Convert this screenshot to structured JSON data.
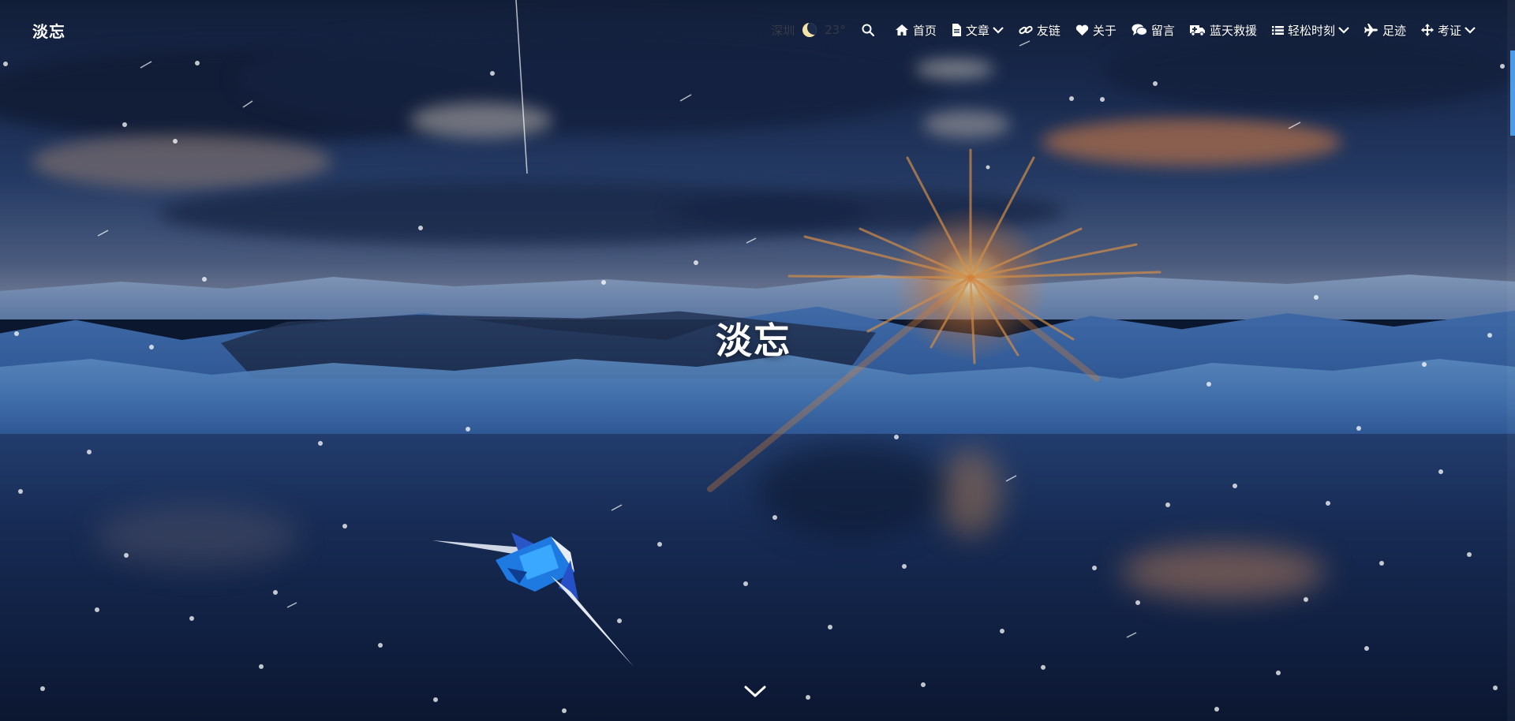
{
  "site": {
    "brand": "淡忘",
    "hero_title": "淡忘"
  },
  "weather": {
    "city": "深圳",
    "temperature": "23°"
  },
  "nav": {
    "items": [
      {
        "label": "首页",
        "icon": "home-icon"
      },
      {
        "label": "文章",
        "icon": "file-icon",
        "has_dropdown": true
      },
      {
        "label": "友链",
        "icon": "link-icon"
      },
      {
        "label": "关于",
        "icon": "heart-icon"
      },
      {
        "label": "留言",
        "icon": "comments-icon"
      },
      {
        "label": "蓝天救援",
        "icon": "truck-icon"
      },
      {
        "label": "轻松时刻",
        "icon": "list-icon",
        "has_dropdown": true
      },
      {
        "label": "足迹",
        "icon": "plane-icon"
      },
      {
        "label": "考证",
        "icon": "arrows-icon",
        "has_dropdown": true
      }
    ]
  },
  "colors": {
    "accent": "#4d9be6",
    "nav_text": "#ffffff"
  }
}
